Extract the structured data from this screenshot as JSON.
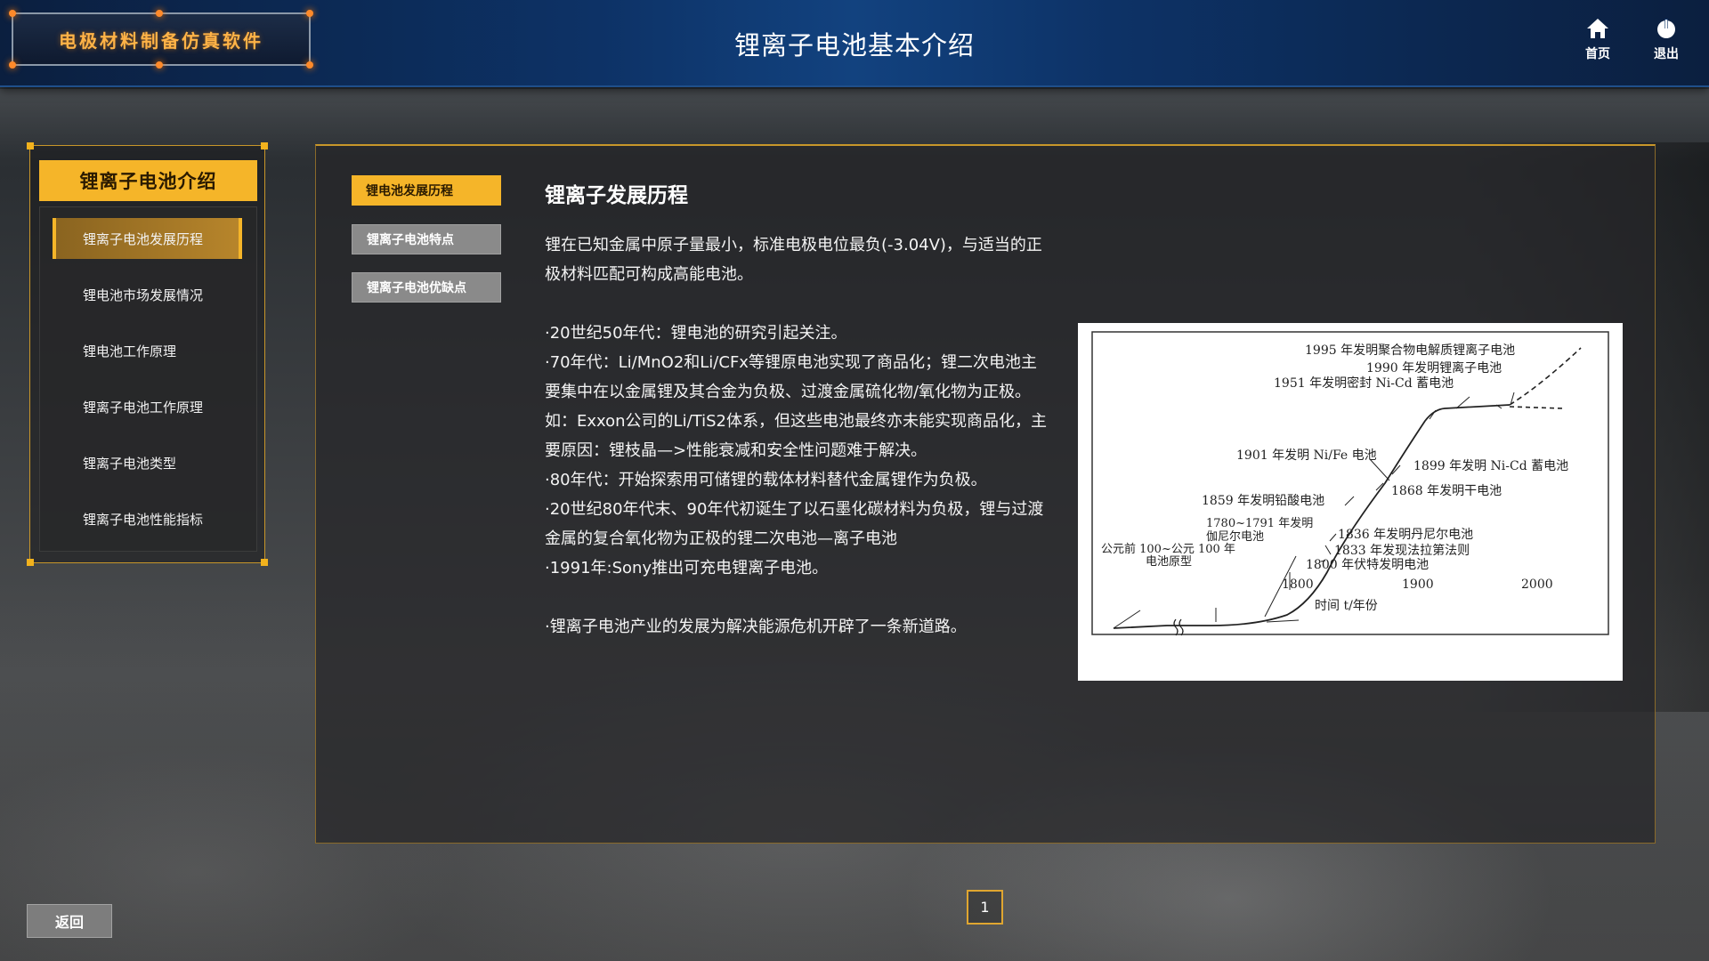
{
  "app": {
    "logo_text": "电极材料制备仿真软件",
    "page_title": "锂离子电池基本介绍"
  },
  "header": {
    "home_label": "首页",
    "exit_label": "退出"
  },
  "sidebar": {
    "title": "锂离子电池介绍",
    "items": [
      {
        "label": "锂离子电池发展历程",
        "active": true
      },
      {
        "label": "锂电池市场发展情况",
        "active": false
      },
      {
        "label": "锂电池工作原理",
        "active": false
      },
      {
        "label": "锂离子电池工作原理",
        "active": false
      },
      {
        "label": "锂离子电池类型",
        "active": false
      },
      {
        "label": "锂离子电池性能指标",
        "active": false
      }
    ]
  },
  "tabs": [
    {
      "label": "锂电池发展历程",
      "active": true
    },
    {
      "label": "锂离子电池特点",
      "active": false
    },
    {
      "label": "锂离子电池优缺点",
      "active": false
    }
  ],
  "content": {
    "title": "锂离子发展历程",
    "intro": "锂在已知金属中原子量最小，标准电极电位最负(-3.04V)，与适当的正极材料匹配可构成高能电池。",
    "bullets": [
      "·20世纪50年代：锂电池的研究引起关注。",
      "·70年代：Li/MnO2和Li/CFx等锂原电池实现了商品化；锂二次电池主要集中在以金属锂及其合金为负极、过渡金属硫化物/氧化物为正极。如：Exxon公司的Li/TiS2体系，但这些电池最终亦未能实现商品化，主要原因：锂枝晶—>性能衰减和安全性问题难于解决。",
      "·80年代：开始探索用可储锂的载体材料替代金属锂作为负极。",
      "·20世纪80年代末、90年代初诞生了以石墨化碳材料为负极，锂与过渡金属的复合氧化物为正极的锂二次电池—离子电池",
      "·1991年:Sony推出可充电锂离子电池。"
    ],
    "conclusion": "·锂离子电池产业的发展为解决能源危机开辟了一条新道路。"
  },
  "figure": {
    "annotations": [
      "1995 年发明聚合物电解质锂离子电池",
      "1990 年发明锂离子电池",
      "1951 年发明密封 Ni-Cd 蓄电池",
      "1901 年发明 Ni/Fe 电池",
      "1899 年发明 Ni-Cd 蓄电池",
      "1868 年发明干电池",
      "1859 年发明铅酸电池",
      "1780~1791 年发明",
      "伽尼尔电池",
      "公元前 100~公元 100 年",
      "电池原型",
      "1836 年发明丹尼尔电池",
      "1833 年发现法拉第法则",
      "1800 年伏特发明电池"
    ],
    "x_ticks": [
      "1800",
      "1900",
      "2000"
    ],
    "x_label": "时间 t/年份"
  },
  "footer": {
    "back_label": "返回",
    "page": "1"
  },
  "colors": {
    "accent": "#f5b529",
    "header_bg": "#0d3266",
    "panel_border": "#c8962a"
  },
  "icons": {
    "home": "home-icon",
    "exit": "power-icon"
  }
}
